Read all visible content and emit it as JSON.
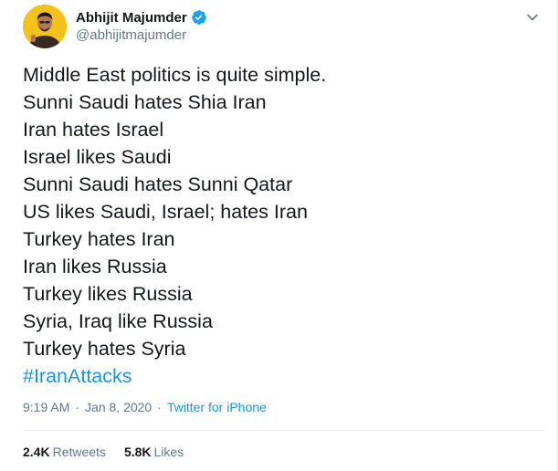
{
  "author": {
    "display_name": "Abhijit Majumder",
    "handle": "@abhijitmajumder",
    "verified_icon": "verified-badge-icon",
    "avatar_bg": "#f4c21d"
  },
  "tweet": {
    "lines": [
      "Middle East politics is quite simple.",
      "Sunni Saudi hates Shia Iran",
      "Iran hates Israel",
      "Israel likes Saudi",
      "Sunni Saudi hates Sunni Qatar",
      "US likes Saudi, Israel; hates Iran",
      "Turkey hates Iran",
      "Iran likes Russia",
      "Turkey likes Russia",
      "Syria, Iraq like Russia",
      "Turkey hates Syria"
    ],
    "hashtag": "#IranAttacks"
  },
  "meta": {
    "time": "9:19 AM",
    "separator": "·",
    "date": "Jan 8, 2020",
    "source": "Twitter for iPhone"
  },
  "stats": {
    "retweets_count": "2.4K",
    "retweets_label": "Retweets",
    "likes_count": "5.8K",
    "likes_label": "Likes"
  },
  "colors": {
    "text": "#14171a",
    "muted": "#657786",
    "link": "#1b95e0",
    "verified": "#1da1f2",
    "divider": "#e6ecf0"
  }
}
